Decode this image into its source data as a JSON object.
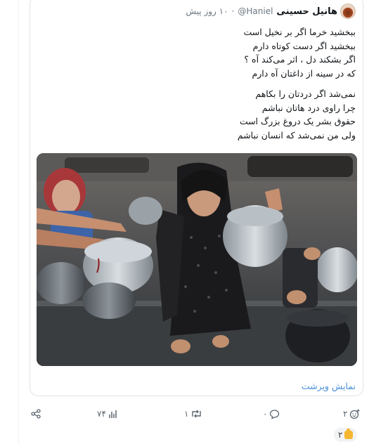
{
  "post": {
    "author_name": "هانیل حسینی",
    "author_handle": "@Haniel",
    "time_ago": "۱۰ روز پیش",
    "stanzas": [
      [
        "ببخشید خرما اگر بر نخیل است",
        "ببخشید اگر دست کوتاه دارم",
        "اگر بشکند دل ، اثر می‌کند آه ؟",
        "که در سینه از داغتان آه دارم"
      ],
      [
        "نمی‌شد اگر دردتان را بکاهم",
        "چرا راوی درد هاتان نباشم",
        "حقوق بشر یک دروغ بزرگ است",
        "ولی من نمی‌شد که انسان نباشم"
      ]
    ],
    "show_thread": "نمایش ویرشت"
  },
  "actions": {
    "react_count": "۲",
    "reply_count": "۰",
    "retweet_count": "۱",
    "views_count": "۷۴"
  },
  "reaction_chip": {
    "emoji": "thumbs-up",
    "count": "۲"
  },
  "icons": [
    "share-icon",
    "views-icon",
    "retweet-icon",
    "reply-icon",
    "add-reaction-icon",
    "thumbs-up-icon"
  ],
  "colors": {
    "link": "#4a90d9",
    "muted": "#6b7680"
  }
}
